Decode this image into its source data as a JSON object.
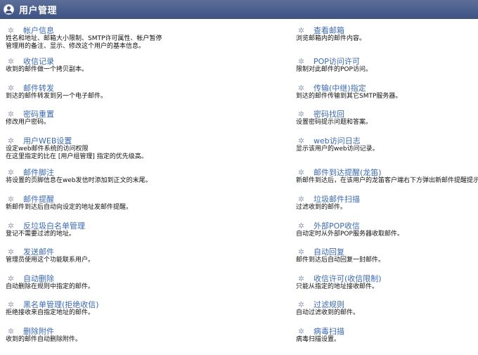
{
  "header": {
    "title": "用户管理"
  },
  "left": [
    {
      "title": "帐户信息",
      "desc": "姓名和地址、邮箱大小限制、SMTP许可属性、帐户暂停\n管理用的备注、显示、修改这个用户的基本信息。"
    },
    {
      "title": "收信记录",
      "desc": "收到的邮件做一个拷贝副本。"
    },
    {
      "title": "邮件转发",
      "desc": "到达的邮件转发到另一个电子邮件。"
    },
    {
      "title": "密码重置",
      "desc": "修改用户密码。"
    },
    {
      "title": "用户WEB设置",
      "desc": "设定web邮件系统的访问权限\n在这里指定的比在 [用户组管理] 指定的优先级高。"
    },
    {
      "title": "邮件脚注",
      "desc": "将设置的页脚信息在web发信时添加到正文的末尾。"
    },
    {
      "title": "邮件提醒",
      "desc": "新邮件到达后自动向设定的地址发邮件提醒。"
    },
    {
      "title": "反垃圾白名单管理",
      "desc": "登记不需要过滤的地址。"
    },
    {
      "title": "发送邮件",
      "desc": "管理员使用这个功能联系用户。"
    },
    {
      "title": "自动删除",
      "desc": "自动删除在规则中指定的邮件。"
    },
    {
      "title": "黑名单管理(拒绝收信)",
      "desc": "拒绝接收来自指定地址的邮件。"
    },
    {
      "title": "删除附件",
      "desc": "收到的邮件自动删除附件。"
    }
  ],
  "right": [
    {
      "title": "查看邮箱",
      "desc": "浏览邮箱内的邮件内容。"
    },
    {
      "title": "POP访问许可",
      "desc": "限制对此邮件的POP访问。"
    },
    {
      "title": "传输(中继)指定",
      "desc": "到达的邮件传输到其它SMTP服务器。"
    },
    {
      "title": "密码找回",
      "desc": "设置密码提示问题和答案。"
    },
    {
      "title": "web访问日志",
      "desc": "显示该用户的web访问记录。"
    },
    {
      "title": "邮件到达提醒(龙笛)",
      "desc": "新邮件到达后，在该用户的龙笛客户端右下方弹出新邮件提醒提示窗口"
    },
    {
      "title": "垃圾邮件扫描",
      "desc": "过滤收到的邮件。"
    },
    {
      "title": "外部POP收信",
      "desc": "自动定时从外部POP服务器收取邮件。"
    },
    {
      "title": "自动回复",
      "desc": "邮件到达后自动回复一封邮件。"
    },
    {
      "title": "收信许可(收信限制)",
      "desc": "只能从指定的地址接收邮件。"
    },
    {
      "title": "过滤规则",
      "desc": "自动过滤收到的邮件。"
    },
    {
      "title": "病毒扫描",
      "desc": "病毒扫描设置。"
    }
  ],
  "icons": {
    "header": "user-icon",
    "item": "gear-icon"
  }
}
